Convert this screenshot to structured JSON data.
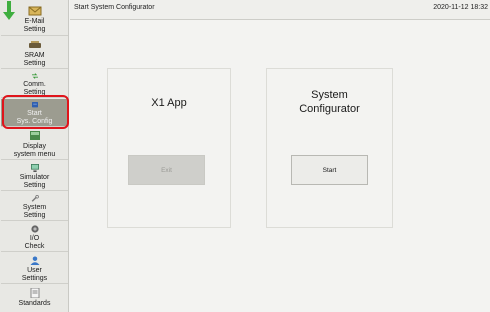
{
  "header": {
    "title": "Start System Configurator",
    "datetime": "2020-11-12 18:32"
  },
  "sidebar": {
    "items": [
      {
        "label": "E-Mail\nSetting",
        "icon": "email-icon"
      },
      {
        "label": "SRAM\nSetting",
        "icon": "sram-icon"
      },
      {
        "label": "Comm.\nSetting",
        "icon": "comm-icon"
      },
      {
        "label": "Start\nSys. Config",
        "icon": "sysconfig-icon",
        "active": true
      },
      {
        "label": "Display\nsystem menu",
        "icon": "display-icon"
      },
      {
        "label": "Simulator\nSetting",
        "icon": "simulator-icon"
      },
      {
        "label": "System\nSetting",
        "icon": "wrench-icon"
      },
      {
        "label": "I/O\nCheck",
        "icon": "io-check-icon"
      },
      {
        "label": "User\nSettings",
        "icon": "user-icon"
      },
      {
        "label": "Standards",
        "icon": "standards-icon"
      }
    ]
  },
  "main": {
    "x1_app": {
      "title": "X1 App",
      "exit_label": "Exit"
    },
    "sys_config": {
      "title": "System\nConfigurator",
      "start_label": "Start"
    }
  },
  "colors": {
    "highlight": "#e0141b",
    "active_item": "#9c9c90"
  }
}
